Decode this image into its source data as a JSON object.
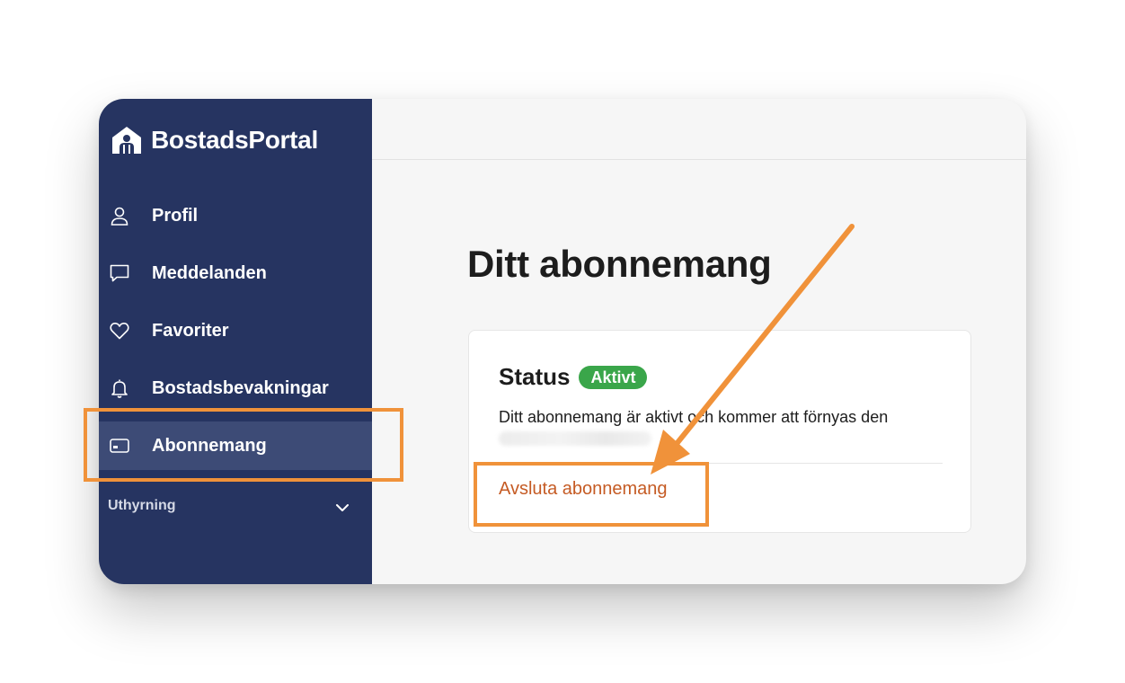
{
  "brand": {
    "name": "BostadsPortal",
    "logo_icon": "house-person-icon"
  },
  "sidebar": {
    "items": [
      {
        "label": "Profil",
        "icon": "user-icon",
        "active": false
      },
      {
        "label": "Meddelanden",
        "icon": "chat-bubble-icon",
        "active": false
      },
      {
        "label": "Favoriter",
        "icon": "heart-icon",
        "active": false
      },
      {
        "label": "Bostadsbevakningar",
        "icon": "bell-icon",
        "active": false
      },
      {
        "label": "Abonnemang",
        "icon": "credit-card-icon",
        "active": true
      }
    ],
    "section": {
      "label": "Uthyrning",
      "icon": "chevron-down-icon"
    }
  },
  "main": {
    "title": "Ditt abonnemang",
    "card": {
      "status_label": "Status",
      "status_badge": "Aktivt",
      "description": "Ditt abonnemang är aktivt och kommer att förnyas den",
      "cancel_link": "Avsluta abonnemang"
    }
  },
  "colors": {
    "sidebar_bg": "#263461",
    "sidebar_active": "#3d4b76",
    "badge_green": "#3aa64a",
    "link_orange": "#c55b24",
    "annotation_orange": "#f0923a"
  }
}
